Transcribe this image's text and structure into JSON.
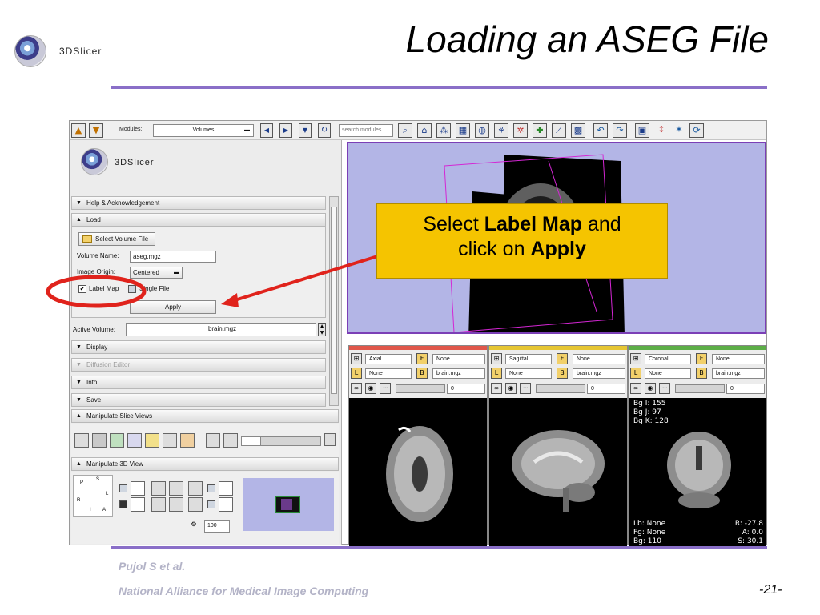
{
  "slide": {
    "title": "Loading an ASEG File",
    "footer_author": "Pujol S et al.",
    "footer_org": "National Alliance for Medical Image Computing",
    "page_number": "-21-",
    "logo_text": "3DSlicer"
  },
  "toolbar": {
    "modules_label": "Modules:",
    "module_value": "Volumes",
    "search_placeholder": "search modules"
  },
  "left_panel": {
    "logo_text": "3DSlicer",
    "sections": {
      "help": "Help & Acknowledgement",
      "load": "Load",
      "display": "Display",
      "diffusion": "Diffusion Editor",
      "info": "Info",
      "save": "Save",
      "manipulate_slice": "Manipulate Slice Views",
      "manipulate_3d": "Manipulate 3D View"
    },
    "load": {
      "select_file_label": "Select Volume File",
      "volume_name_label": "Volume Name:",
      "volume_name_value": "aseg.mgz",
      "image_origin_label": "Image Origin:",
      "image_origin_value": "Centered",
      "label_map_label": "Label Map",
      "label_map_checked": true,
      "single_file_label": "Single File",
      "single_file_checked": false,
      "apply_label": "Apply"
    },
    "active_volume_label": "Active Volume:",
    "active_volume_value": "brain.mgz",
    "view3d_zoom": "100",
    "orientation": {
      "p": "P",
      "s": "S",
      "l": "L",
      "r": "R",
      "i": "I",
      "a": "A"
    }
  },
  "slices": [
    {
      "name": "Axial",
      "fg": "None",
      "bg": "None",
      "lb": "brain.mgz",
      "opacity": "0",
      "color": "#e0574a"
    },
    {
      "name": "Sagittal",
      "fg": "None",
      "bg": "None",
      "lb": "brain.mgz",
      "opacity": "0",
      "color": "#e6c633"
    },
    {
      "name": "Coronal",
      "fg": "None",
      "bg": "None",
      "lb": "brain.mgz",
      "opacity": "0",
      "color": "#5cae47"
    }
  ],
  "coronal_overlay": {
    "bg_i": "Bg I: 155",
    "bg_j": "Bg J: 97",
    "bg_k": "Bg K: 128",
    "lb": "Lb: None",
    "fg": "Fg: None",
    "bg": "Bg: 110",
    "r": "R: -27.8",
    "a": "A: 0.0",
    "s": "S: 30.1"
  },
  "callout": {
    "line1_prefix": "Select ",
    "line1_bold": "Label Map",
    "line1_suffix": " and",
    "line2_prefix": "click on ",
    "line2_bold": "Apply"
  },
  "colors": {
    "accent_rule": "#8a6fc8",
    "callout_bg": "#f5c400",
    "annotation_red": "#e0231c",
    "view3d_bg": "#b3b5e6"
  }
}
